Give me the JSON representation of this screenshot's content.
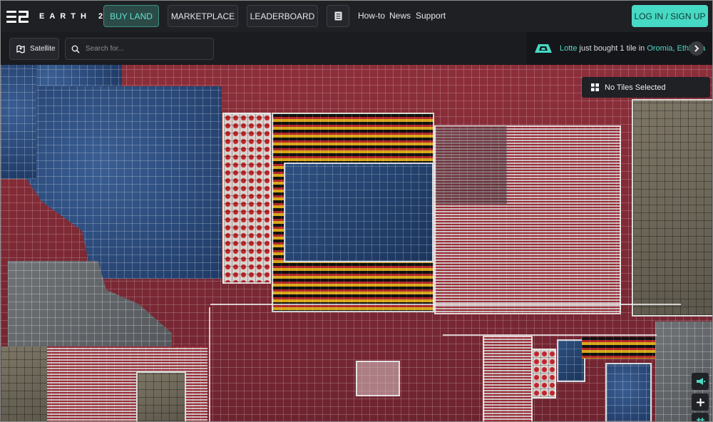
{
  "nav": {
    "logo_text": "EARTH 2",
    "buy_land": "BUY LAND",
    "marketplace": "MARKETPLACE",
    "leaderboard": "LEADERBOARD",
    "howto": "How-to",
    "news": "News",
    "support": "Support",
    "login": "LOG IN / SIGN UP"
  },
  "toolbar": {
    "satellite_label": "Satellite",
    "search_placeholder": "Search for..."
  },
  "ticker": {
    "user": "Lotte",
    "action": " just bought 1 tile in ",
    "location": "Oromia, Ethiopia"
  },
  "selection": {
    "label": "No Tiles Selected"
  },
  "colors": {
    "accent": "#46d9c4",
    "background": "#1e2024"
  }
}
